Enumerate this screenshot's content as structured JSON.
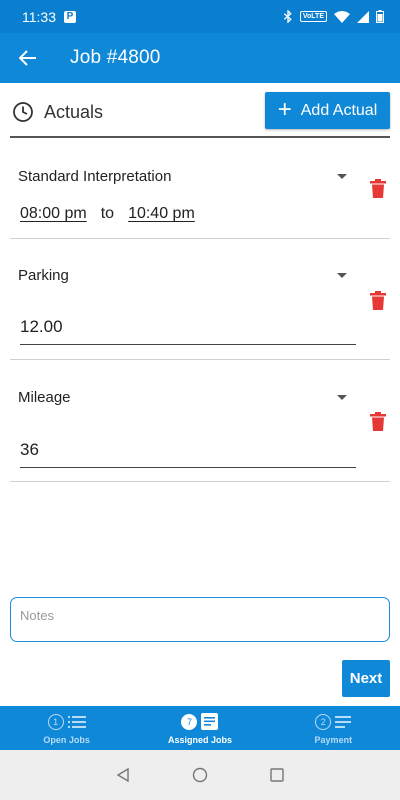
{
  "status_bar": {
    "time": "11:33",
    "notification_letter": "P",
    "network_label": "VoLTE"
  },
  "app_bar": {
    "title": "Job #4800",
    "back_icon": "arrow-left-icon"
  },
  "actuals": {
    "section_label": "Actuals",
    "add_button_label": "Add Actual",
    "items": [
      {
        "type": "Standard Interpretation",
        "start_time": "08:00 pm",
        "to_label": "to",
        "end_time": "10:40 pm"
      },
      {
        "type": "Parking",
        "value": "12.00"
      },
      {
        "type": "Mileage",
        "value": "36"
      }
    ]
  },
  "notes": {
    "placeholder": "Notes"
  },
  "next_button_label": "Next",
  "bottom_nav": {
    "items": [
      {
        "badge": "1",
        "label": "Open Jobs",
        "active": false
      },
      {
        "badge": "7",
        "label": "Assigned Jobs",
        "active": true
      },
      {
        "badge": "2",
        "label": "Payment",
        "active": false
      }
    ]
  },
  "colors": {
    "primary": "#0f88d8",
    "status_bar": "#0b7fcf",
    "delete": "#e53935"
  }
}
